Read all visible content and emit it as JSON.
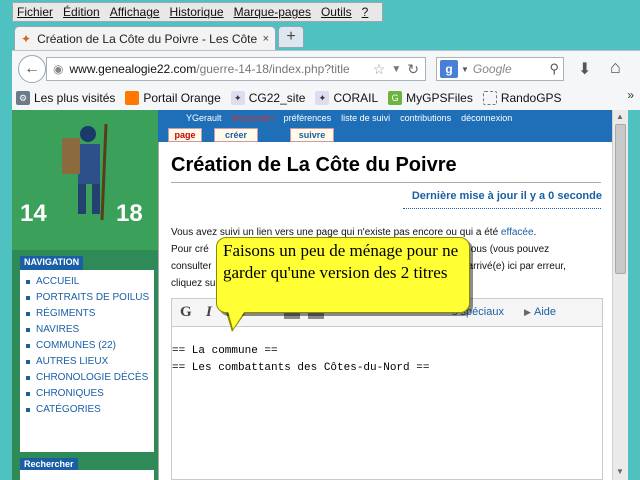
{
  "menubar": [
    "Fichier",
    "Édition",
    "Affichage",
    "Historique",
    "Marque-pages",
    "Outils",
    "?"
  ],
  "tab": {
    "title": "Création de La Côte du Poivre - Les Côte...",
    "close": "×",
    "new_tab": "+"
  },
  "url": {
    "host": "www.genealogie22.com",
    "path": "/guerre-14-18/index.php?title"
  },
  "search": {
    "engine_letter": "g",
    "placeholder": "Google"
  },
  "bookmarks": [
    {
      "label": "Les plus visités",
      "icon": "gear-icon"
    },
    {
      "label": "Portail Orange",
      "icon": "orange-icon"
    },
    {
      "label": "CG22_site",
      "icon": "site-icon"
    },
    {
      "label": "CORAIL",
      "icon": "site-icon"
    },
    {
      "label": "MyGPSFiles",
      "icon": "gps-icon"
    },
    {
      "label": "RandoGPS",
      "icon": "page-icon"
    }
  ],
  "bookmarks_more": "»",
  "wiki": {
    "logo": {
      "left": "14",
      "right": "18"
    },
    "navigation_title": "NAVIGATION",
    "nav_items": [
      "ACCUEIL",
      "PORTRAITS DE POILUS",
      "RÉGIMENTS",
      "NAVIRES",
      "COMMUNES (22)",
      "AUTRES LIEUX",
      "CHRONOLOGIE DÉCÈS",
      "CHRONIQUES",
      "CATÉGORIES"
    ],
    "search_title": "Rechercher",
    "personal": {
      "user": "YGerault",
      "discussion": "discussion",
      "preferences": "préférences",
      "watchlist": "liste de suivi",
      "contributions": "contributions",
      "logout": "déconnexion"
    },
    "tabs": {
      "page": "page",
      "create": "créer",
      "watch": "suivre"
    }
  },
  "content": {
    "title": "Création de La Côte du Poivre",
    "last_update": "Dernière mise à jour il y a 0 seconde",
    "intro_line1": "Vous avez suivi un lien vers une page qui n'existe pas encore ou qui a été",
    "intro_link": "effacée",
    "intro_line2_start": "Pour cré",
    "intro_line2_end": "ous (vous pouvez",
    "intro_line3_start": "consulter",
    "intro_line3_end": "arrivé(e) ici par erreur,",
    "intro_line4_start": "cliquez su"
  },
  "editor": {
    "bold": "G",
    "italic": "I",
    "special": "s spéciaux",
    "help": "Aide",
    "lines": [
      "== La commune ==",
      "== Les combattants des Côtes-du-Nord =="
    ]
  },
  "balloon": "Faisons un peu de ménage pour ne garder qu'une version des 2 titres"
}
